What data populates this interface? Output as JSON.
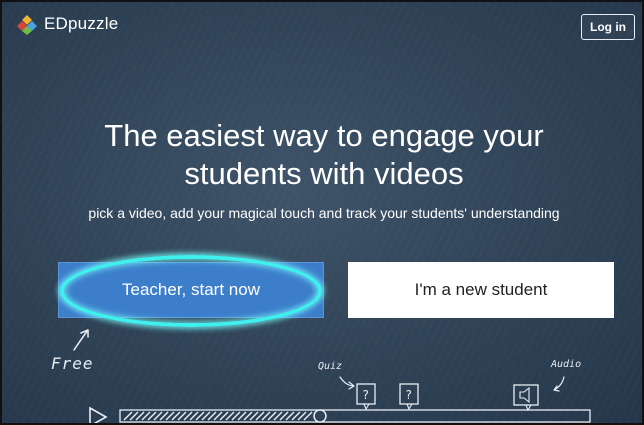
{
  "header": {
    "brand_name": "EDpuzzle",
    "login_label": "Log in"
  },
  "hero": {
    "headline_line1": "The easiest way to engage your",
    "headline_line2": "students with videos",
    "subheadline": "pick a video, add your magical touch and track your students' understanding"
  },
  "cta": {
    "teacher_label": "Teacher, start now",
    "student_label": "I'm a new student"
  },
  "chalk": {
    "free_label": "Free",
    "quiz_label": "Quiz",
    "audio_label": "Audio"
  },
  "colors": {
    "board": "#2f4256",
    "teacher_button": "#3d7ecb",
    "student_button": "#ffffff",
    "highlight": "#3ff0ee"
  },
  "icons": {
    "logo": "puzzle-logo-icon",
    "quiz": "question-box-icon",
    "audio": "speaker-icon",
    "play": "play-icon"
  }
}
